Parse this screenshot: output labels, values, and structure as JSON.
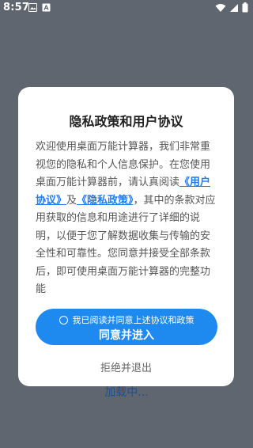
{
  "status_bar": {
    "time": "8:57",
    "icons": [
      "image-icon",
      "app-icon",
      "wifi-icon",
      "signal-icon",
      "battery-icon"
    ]
  },
  "background": {
    "loading_text": "加载中..."
  },
  "dialog": {
    "title": "隐私政策和用户协议",
    "body": {
      "intro": "欢迎使用桌面万能计算器，我们非常重视您的隐私和个人信息保护。在您使用桌面万能计算器前，请认真阅读",
      "user_agreement": "《用户协议》",
      "and": "及",
      "privacy_policy": "《隐私政策》",
      "rest": "，其中的条款对应用获取的信息和用途进行了详细的说明，以便于您了解数据收集与传输的安全性和可靠性。您同意并接受全部条款后，即可使用桌面万能计算器的完整功能"
    },
    "agree_checkbox_label": "我已阅读并同意上述协议和政策",
    "agree_button_label": "同意并进入",
    "refuse_label": "拒绝并退出"
  },
  "colors": {
    "overlay": "#5f6670",
    "primary": "#1e8af0",
    "link": "#1d7cf2"
  }
}
